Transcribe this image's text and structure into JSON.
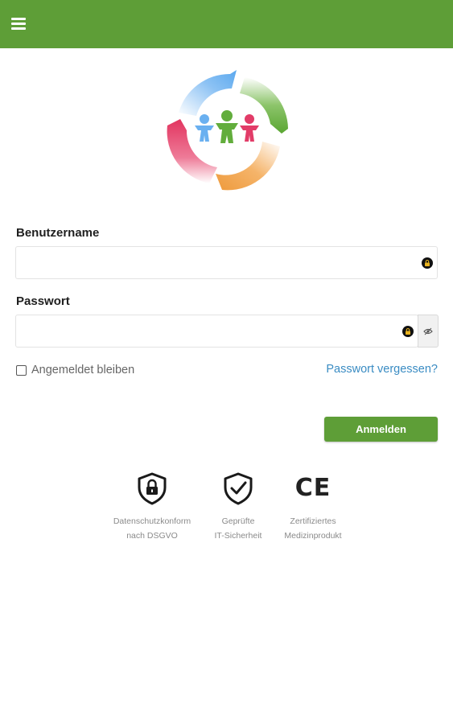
{
  "header": {
    "menu_icon": "hamburger-menu-icon",
    "color": "#5e9e37"
  },
  "logo": {
    "name": "family-circle-logo",
    "colors": [
      "#6ab0f0",
      "#62ad3c",
      "#f0a04a",
      "#e23c68"
    ]
  },
  "form": {
    "username": {
      "label": "Benutzername",
      "value": "",
      "placeholder": "",
      "icon": "lock-icon"
    },
    "password": {
      "label": "Passwort",
      "value": "",
      "placeholder": "",
      "icon": "lock-icon",
      "toggle_icon": "eye-icon"
    },
    "remember_label": "Angemeldet bleiben",
    "remember_checked": false,
    "forgot_label": "Passwort vergessen?",
    "submit_label": "Anmelden"
  },
  "badges": [
    {
      "icon": "shield-lock-icon",
      "line1": "Datenschutzkonform",
      "line2": "nach DSGVO"
    },
    {
      "icon": "shield-check-icon",
      "line1": "Geprüfte",
      "line2": "IT-Sicherheit"
    },
    {
      "icon": "ce-mark-icon",
      "mark": "CE",
      "line1": "Zertifiziertes",
      "line2": "Medizinprodukt"
    }
  ],
  "colors": {
    "accent": "#5e9e37",
    "link": "#3a8cc3"
  }
}
